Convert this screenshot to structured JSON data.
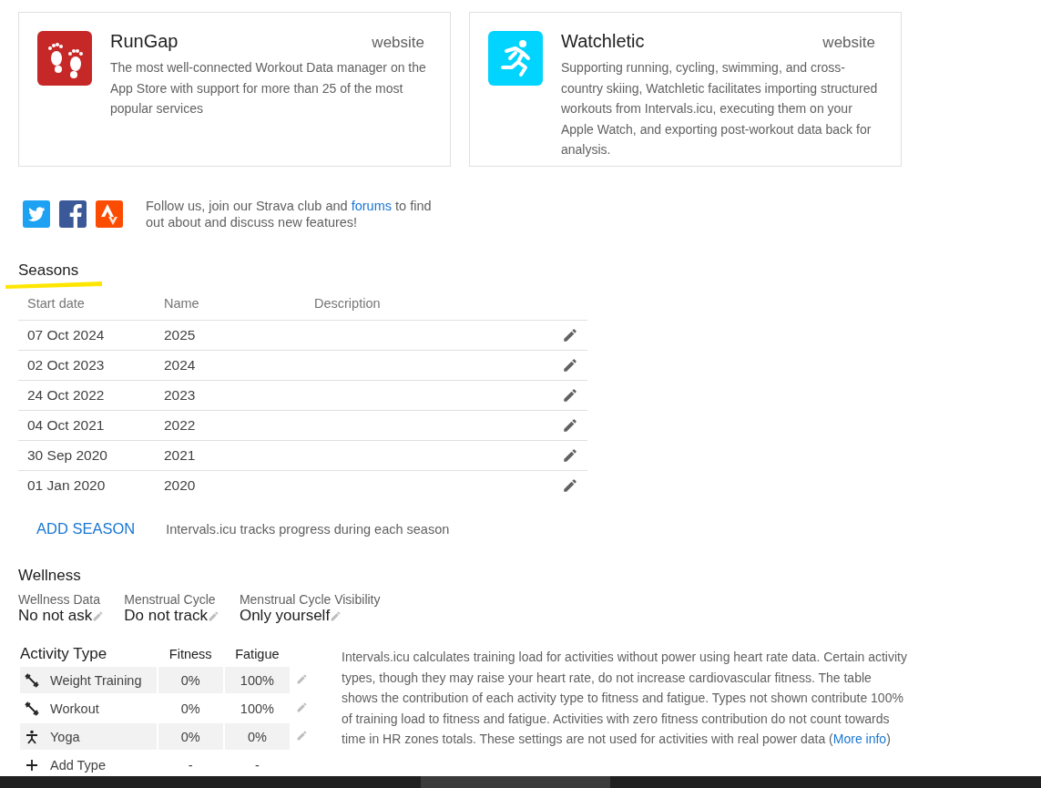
{
  "apps": [
    {
      "kind": "rungap",
      "name": "RunGap",
      "link": "website",
      "description": "The most well-connected Workout Data manager on the App Store with support for more than 25 of the most popular services"
    },
    {
      "kind": "watchletic",
      "name": "Watchletic",
      "link": "website",
      "description": "Supporting running, cycling, swimming, and cross-country skiing, Watchletic facilitates importing structured workouts from Intervals.icu, executing them on your Apple Watch, and exporting post-workout data back for analysis."
    }
  ],
  "social": {
    "text_before": "Follow us, join our Strava club and",
    "link": "forums",
    "text_after": "to find out about and discuss new features!"
  },
  "seasons": {
    "title": "Seasons",
    "columns": [
      "Start date",
      "Name",
      "Description"
    ],
    "rows": [
      {
        "start_date": "07 Oct 2024",
        "name": "2025"
      },
      {
        "start_date": "02 Oct 2023",
        "name": "2024"
      },
      {
        "start_date": "24 Oct 2022",
        "name": "2023"
      },
      {
        "start_date": "04 Oct 2021",
        "name": "2022"
      },
      {
        "start_date": "30 Sep 2020",
        "name": "2021"
      },
      {
        "start_date": "01 Jan 2020",
        "name": "2020"
      }
    ],
    "add_button": "ADD SEASON",
    "hint": "Intervals.icu tracks progress during each season"
  },
  "wellness": {
    "title": "Wellness",
    "fields": [
      {
        "label": "Wellness Data",
        "value": "No not ask"
      },
      {
        "label": "Menstrual Cycle",
        "value": "Do not track"
      },
      {
        "label": "Menstrual Cycle Visibility",
        "value": "Only yourself"
      }
    ]
  },
  "activity_types": {
    "columns": [
      "Activity Type",
      "Fitness",
      "Fatigue"
    ],
    "rows": [
      {
        "kind": "dumbbell",
        "name": "Weight Training",
        "fitness": "0%",
        "fatigue": "100%",
        "shaded": true
      },
      {
        "kind": "dumbbell",
        "name": "Workout",
        "fitness": "0%",
        "fatigue": "100%",
        "shaded": false
      },
      {
        "kind": "yoga",
        "name": "Yoga",
        "fitness": "0%",
        "fatigue": "0%",
        "shaded": true
      },
      {
        "kind": "add",
        "name": "Add Type",
        "fitness": "-",
        "fatigue": "-",
        "shaded": false
      }
    ],
    "description": "Intervals.icu calculates training load for activities without power using heart rate data. Certain activity types, though they may raise your heart rate, do not increase cardiovascular fitness. The table shows the contribution of each activity type to fitness and fatigue. Types not shown contribute 100% of training load to fitness and fatigue. Activities with zero fitness contribution do not count towards time in HR zones totals. These settings are not used for activities with real power data (",
    "link": "More info",
    "description_end": ")"
  }
}
